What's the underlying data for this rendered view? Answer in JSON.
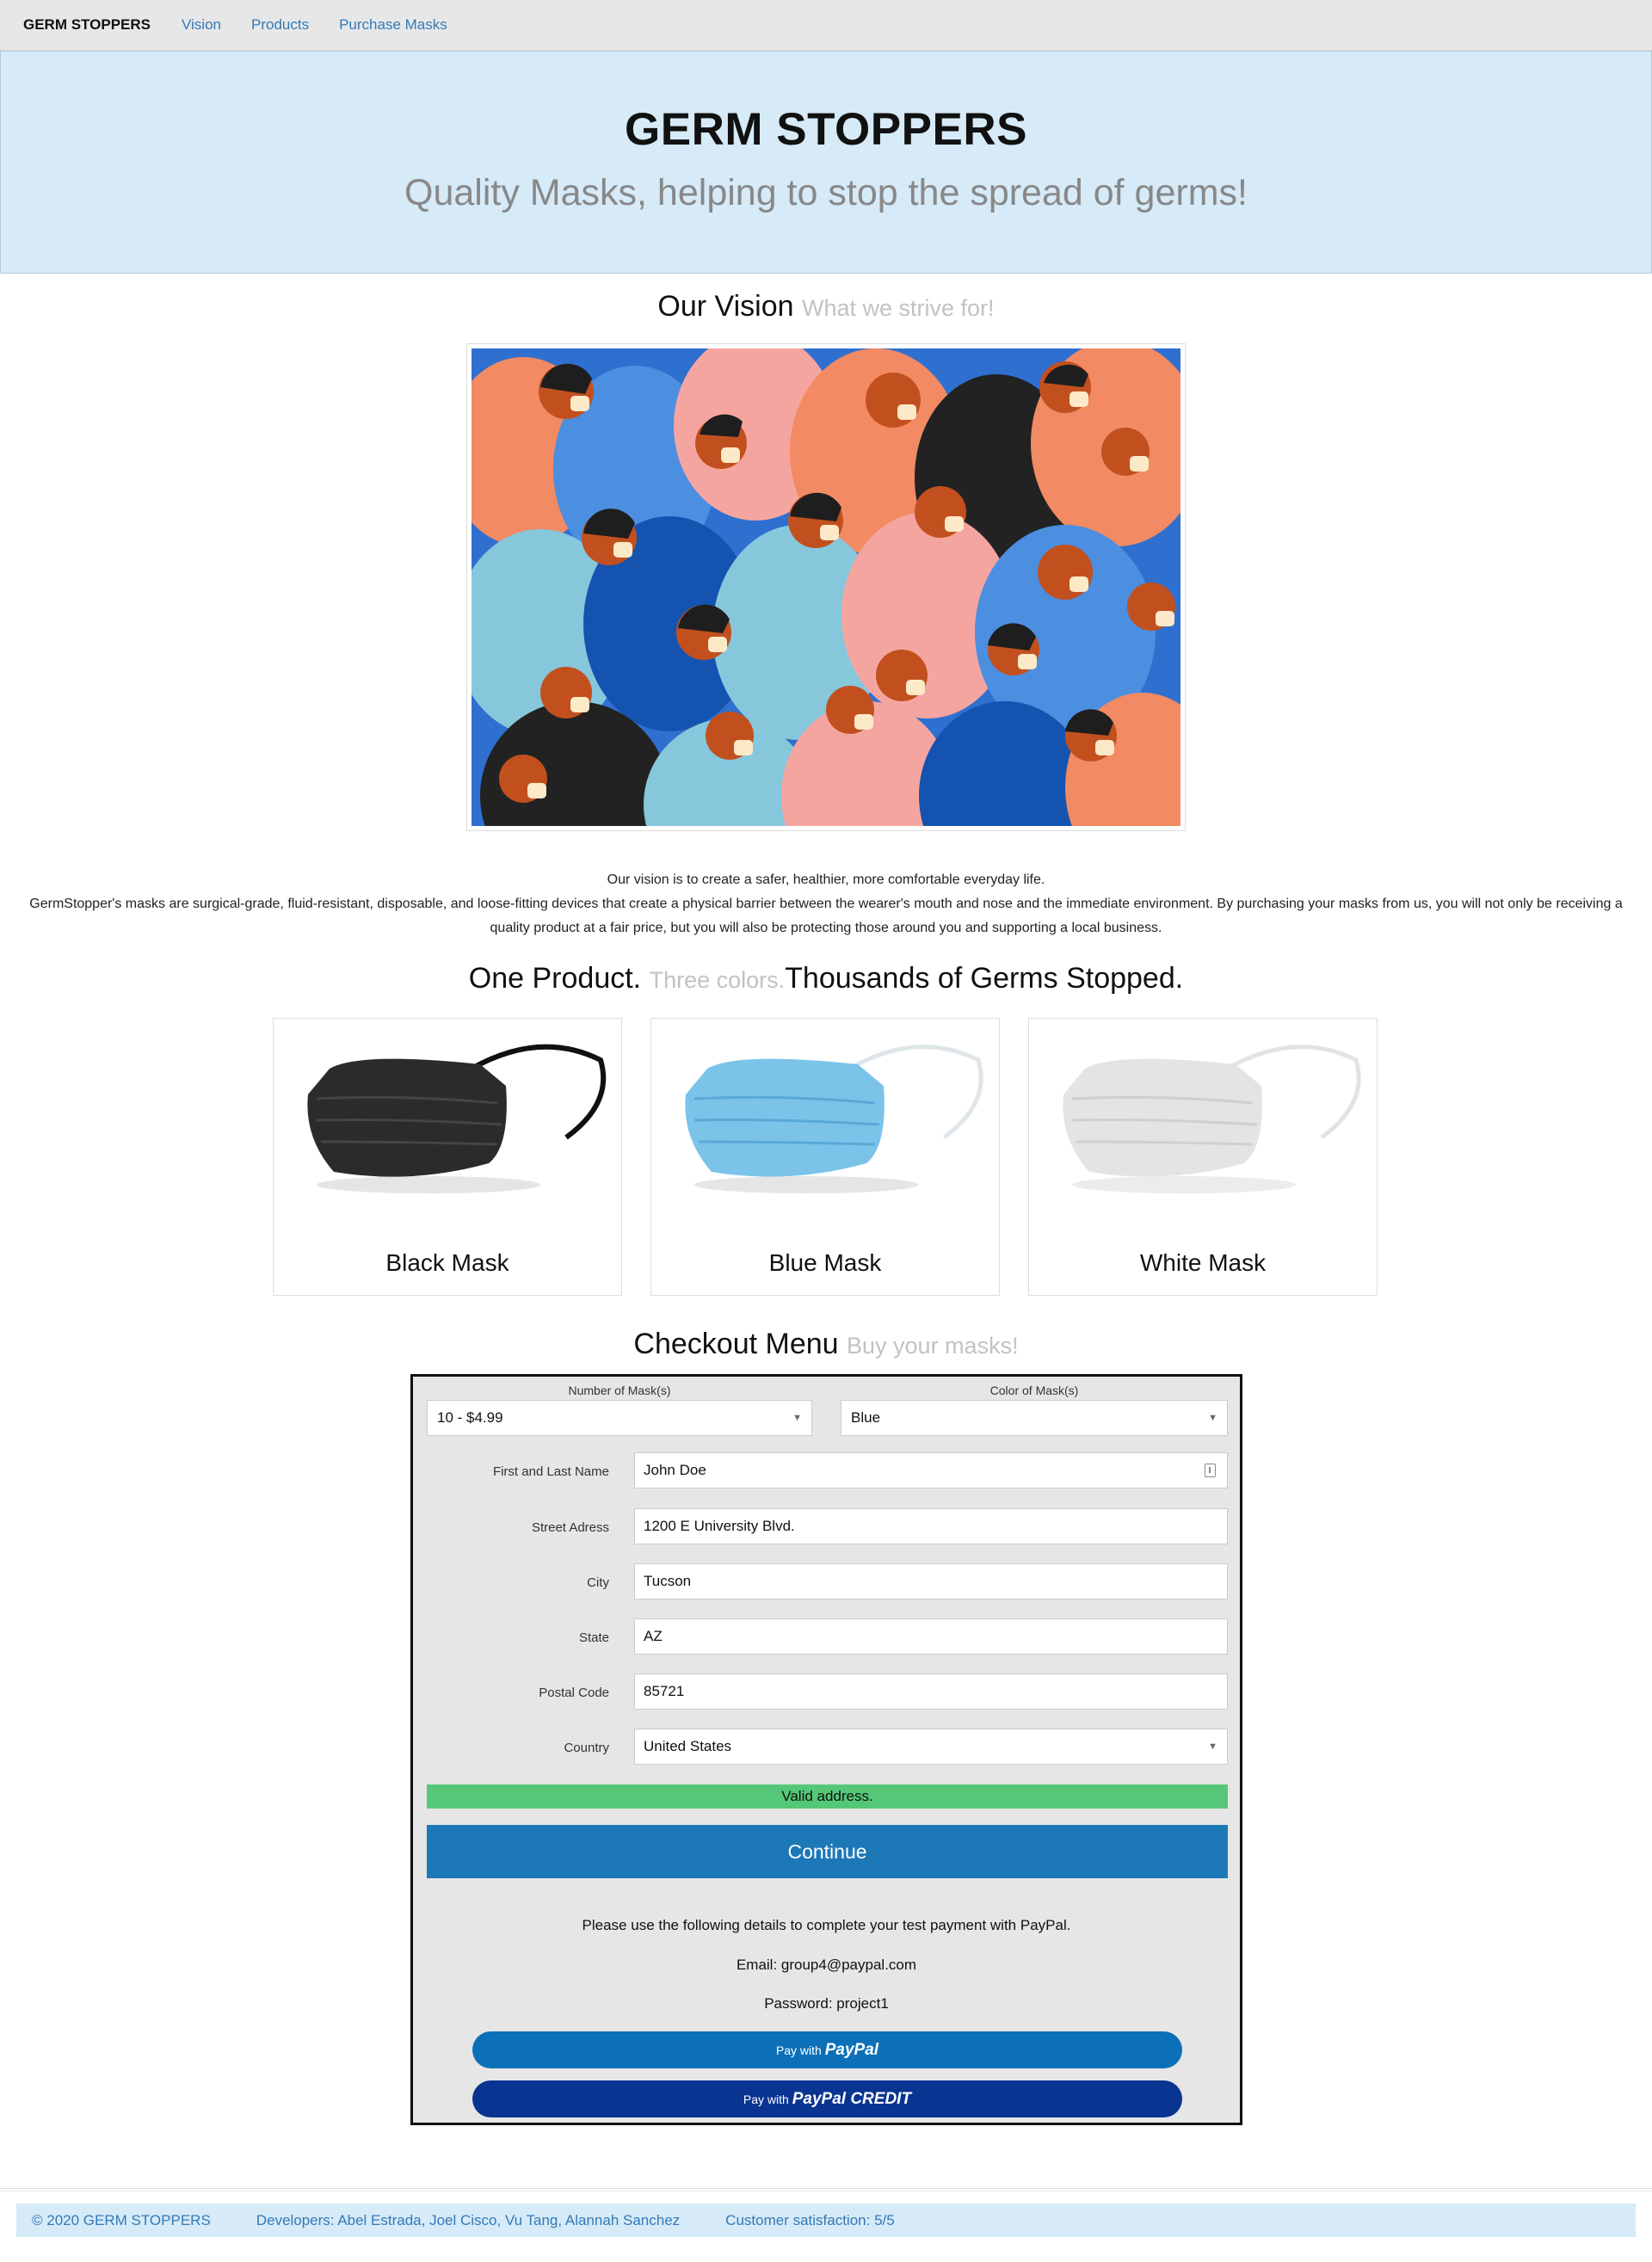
{
  "nav": {
    "brand": "GERM STOPPERS",
    "links": [
      "Vision",
      "Products",
      "Purchase Masks"
    ]
  },
  "hero": {
    "title": "GERM STOPPERS",
    "subtitle": "Quality Masks, helping to stop the spread of germs!"
  },
  "vision": {
    "heading": "Our Vision",
    "heading_muted": "What we strive for!",
    "text_line1": "Our vision is to create a safer, healthier, more comfortable everyday life.",
    "text_line2": "GermStopper's masks are surgical-grade, fluid-resistant, disposable, and loose-fitting devices that create a physical barrier between the wearer's mouth and nose and the immediate environment. By purchasing your masks from us, you will not only be receiving a quality product at a fair price, but you will also be protecting those around you and supporting a local business."
  },
  "products": {
    "heading_a": "One Product.",
    "heading_muted": "Three colors.",
    "heading_b": "Thousands of Germs Stopped.",
    "items": [
      {
        "label": "Black Mask",
        "color": "#2b2b2b"
      },
      {
        "label": "Blue Mask",
        "color": "#7cc3ea"
      },
      {
        "label": "White Mask",
        "color": "#e4e4e4"
      }
    ]
  },
  "checkout": {
    "heading": "Checkout Menu",
    "heading_muted": "Buy your masks!",
    "quantity_label": "Number of Mask(s)",
    "quantity_value": "10 - $4.99",
    "color_label": "Color of Mask(s)",
    "color_value": "Blue",
    "fields": {
      "name_label": "First and Last Name",
      "name_value": "John Doe",
      "street_label": "Street Adress",
      "street_value": "1200 E University Blvd.",
      "city_label": "City",
      "city_value": "Tucson",
      "state_label": "State",
      "state_value": "AZ",
      "postal_label": "Postal Code",
      "postal_value": "85721",
      "country_label": "Country",
      "country_value": "United States"
    },
    "valid_text": "Valid address.",
    "continue_label": "Continue",
    "info_line1": "Please use the following details to complete your test payment with PayPal.",
    "info_email": "Email: group4@paypal.com",
    "info_password": "Password: project1",
    "paypal_prefix": "Pay with",
    "paypal_brand": "PayPal",
    "paypal_credit_brand": "PayPal CREDIT"
  },
  "footer": {
    "copyright": "© 2020 GERM STOPPERS",
    "developers": "Developers: Abel Estrada, Joel Cisco, Vu Tang, Alannah Sanchez",
    "satisfaction": "Customer satisfaction: 5/5"
  },
  "colors": {
    "nav_bg": "#e7e7e7",
    "hero_bg": "#d6eaf8",
    "link": "#337ab7",
    "valid_green": "#54c878",
    "continue_blue": "#1d78b8",
    "paypal_blue": "#0c70b8",
    "paypal_credit_navy": "#0a3491"
  }
}
